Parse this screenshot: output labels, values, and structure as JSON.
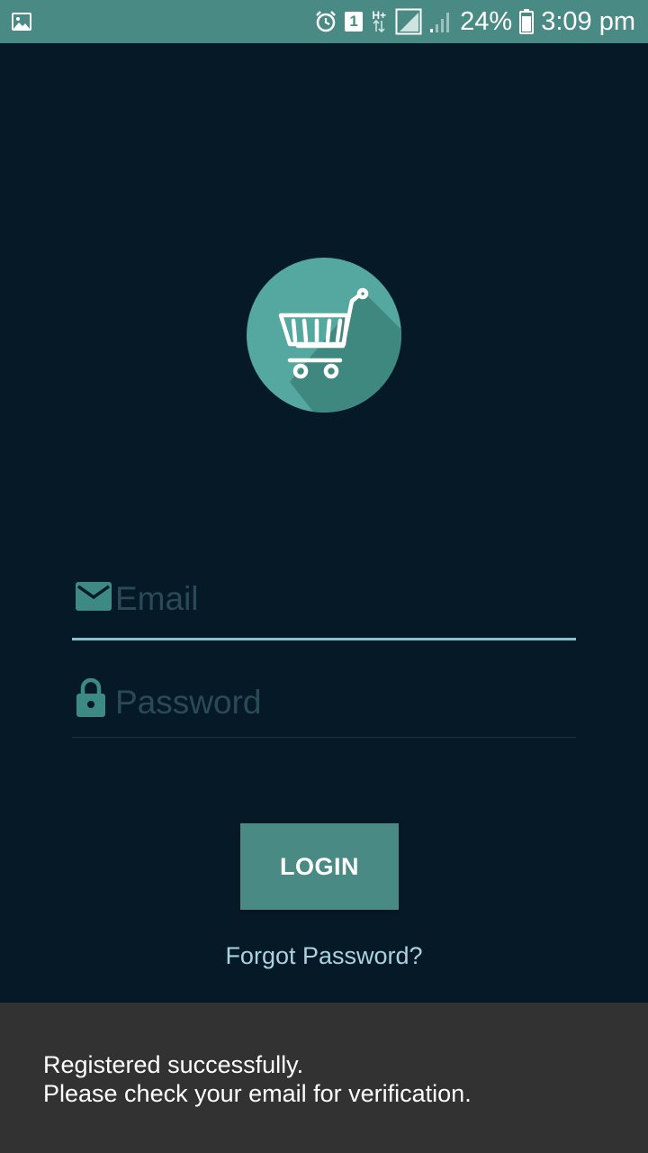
{
  "status_bar": {
    "battery_percent": "24%",
    "time": "3:09 pm",
    "sim_slot": "1",
    "network_type": "H+",
    "icons": [
      "image-notification-icon",
      "alarm-icon",
      "sim-icon",
      "data-transfer-icon",
      "signal-icon",
      "signal-icon-2",
      "battery-icon"
    ]
  },
  "logo": {
    "icon": "shopping-cart-icon",
    "circle_color": "#55a89f",
    "shadow_color": "#3f8880"
  },
  "login_form": {
    "email": {
      "placeholder": "Email",
      "value": "",
      "icon": "email-icon"
    },
    "password": {
      "placeholder": "Password",
      "value": "",
      "icon": "lock-icon"
    },
    "login_label": "LOGIN",
    "forgot_label": "Forgot Password?"
  },
  "toast": {
    "line1": "Registered successfully.",
    "line2": "Please check your email for verification."
  },
  "colors": {
    "background": "#061926",
    "accent": "#4a8a85",
    "field_focus_underline": "#86c3cc",
    "link": "#a9d4dc",
    "toast_background": "#323232"
  }
}
